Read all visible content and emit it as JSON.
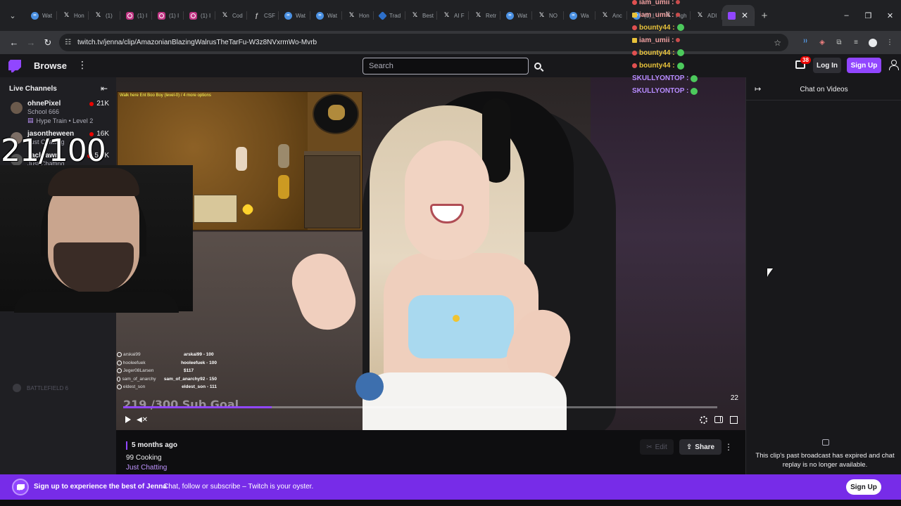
{
  "browser": {
    "tabs": [
      {
        "icon": "blue",
        "label": "Wat"
      },
      {
        "icon": "x",
        "label": "Hon"
      },
      {
        "icon": "x",
        "label": "(1)"
      },
      {
        "icon": "ig",
        "label": "(1) I"
      },
      {
        "icon": "ig",
        "label": "(1) I"
      },
      {
        "icon": "ig",
        "label": "(1) I"
      },
      {
        "icon": "x",
        "label": "Cod"
      },
      {
        "icon": "csf",
        "label": "CSF"
      },
      {
        "icon": "blue",
        "label": "Wat"
      },
      {
        "icon": "blue",
        "label": "Wat"
      },
      {
        "icon": "x",
        "label": "Hon"
      },
      {
        "icon": "trad",
        "label": "Trad"
      },
      {
        "icon": "x",
        "label": "Best"
      },
      {
        "icon": "x",
        "label": "AI F"
      },
      {
        "icon": "x",
        "label": "Retr"
      },
      {
        "icon": "blue",
        "label": "Wat"
      },
      {
        "icon": "x",
        "label": "NO"
      },
      {
        "icon": "blue",
        "label": "Wa"
      },
      {
        "icon": "x",
        "label": "Anc"
      },
      {
        "icon": "blue",
        "label": "(1) I"
      },
      {
        "icon": "x",
        "label": "Figh"
      },
      {
        "icon": "x",
        "label": "ADI"
      }
    ],
    "url": "twitch.tv/jenna/clip/AmazonianBlazingWalrusTheTarFu-W3z8NVxrmWo-Mvrb"
  },
  "topnav": {
    "browse": "Browse",
    "search_placeholder": "Search",
    "notification_count": "38",
    "login": "Log In",
    "signup": "Sign Up"
  },
  "sidebar": {
    "header": "Live Channels",
    "channels": [
      {
        "name": "ohnePixel",
        "game": "School 666",
        "viewers": "21K",
        "hype": "Hype Train • Level 2"
      },
      {
        "name": "jasontheween",
        "game": "Just Chatting",
        "viewers": "16K"
      },
      {
        "name": "zackrawr",
        "game": "Just Chatting",
        "viewers": "5.5K"
      }
    ],
    "overlay_counter": "21/100",
    "ghost_text": "BATTLEFIELD 6"
  },
  "player": {
    "leaderboard": [
      {
        "name": "arskai99",
        "value": "arskai99 - 100"
      },
      {
        "name": "hooleefuek",
        "value": "hooleefuek - 100"
      },
      {
        "name": "Jeger08Larsen",
        "value": "$117"
      },
      {
        "name": "sam_of_anarchy",
        "value": "sam_of_anarchy92 - 150"
      },
      {
        "name": "eldest_son",
        "value": "eldest_son - 111"
      }
    ],
    "subgoal_text": "219 /300 Sub Goal",
    "progress": 0.25,
    "time": "22",
    "game_hud": "Walk here Ent Boo Boy (level-0) / 4 more options"
  },
  "clip_info": {
    "posted": "5 months ago",
    "title": "99 Cooking",
    "category": "Just Chatting",
    "edit": "Edit",
    "share": "Share"
  },
  "chat": {
    "title": "Chat on Videos",
    "message": "This clip's past broadcast has expired and chat replay is no longer available."
  },
  "overlay_chat": [
    {
      "user": "iam_umii :",
      "color": "#f0a0a0",
      "badge": "red",
      "emote": "small"
    },
    {
      "user": "iam_umii :",
      "color": "#f0a0a0",
      "badge": "crown",
      "emote": "small"
    },
    {
      "user": "bounty44 :",
      "color": "#e8c23a",
      "badge": "red",
      "emote": "green"
    },
    {
      "user": "iam_umii :",
      "color": "#f0a0a0",
      "badge": "crown",
      "emote": "small"
    },
    {
      "user": "bounty44 :",
      "color": "#e8c23a",
      "badge": "red",
      "emote": "green"
    },
    {
      "user": "bounty44 :",
      "color": "#e8c23a",
      "badge": "red",
      "emote": "green"
    },
    {
      "user": "SKULLYONTOP :",
      "color": "#b78cff",
      "badge": "none",
      "emote": "green"
    },
    {
      "user": "SKULLYONTOP :",
      "color": "#b78cff",
      "badge": "none",
      "emote": "green"
    }
  ],
  "banner": {
    "bold": "Sign up to experience the best of Jenna",
    "sub": "Chat, follow or subscribe – Twitch is your oyster.",
    "button": "Sign Up"
  },
  "colors": {
    "twitch_purple": "#9146ff",
    "banner": "#772ce8",
    "background": "#0e0e10"
  }
}
